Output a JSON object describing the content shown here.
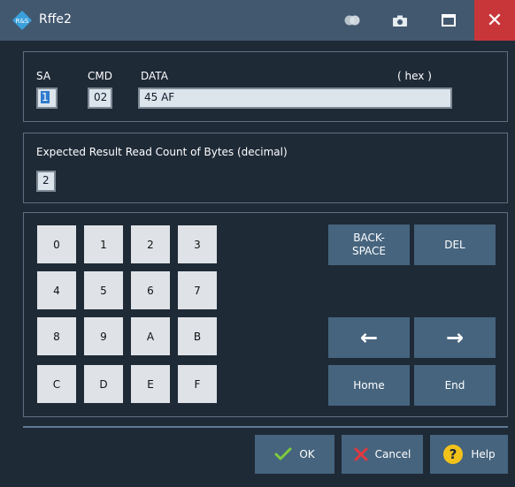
{
  "window": {
    "title": "Rffe2"
  },
  "request": {
    "sa_label": "SA",
    "cmd_label": "CMD",
    "data_label": "DATA",
    "hex_label": "( hex )",
    "sa_value": "1",
    "cmd_value": "02",
    "data_value": "45 AF"
  },
  "expected": {
    "label": "Expected Result Read Count of Bytes (decimal)",
    "value": "2"
  },
  "keypad": {
    "keys": [
      "0",
      "1",
      "2",
      "3",
      "4",
      "5",
      "6",
      "7",
      "8",
      "9",
      "A",
      "B",
      "C",
      "D",
      "E",
      "F"
    ],
    "backspace_line1": "BACK-",
    "backspace_line2": "SPACE",
    "del": "DEL",
    "left_arrow": "←",
    "right_arrow": "→",
    "home": "Home",
    "end": "End"
  },
  "footer": {
    "ok": "OK",
    "cancel": "Cancel",
    "help": "Help"
  },
  "colors": {
    "background": "#1f2a37",
    "titlebar": "#42586f",
    "close": "#c8363a",
    "button": "#46647e",
    "ok_check": "#7ecb3d",
    "cancel_x": "#e0393e",
    "help_icon": "#f2c21b"
  }
}
